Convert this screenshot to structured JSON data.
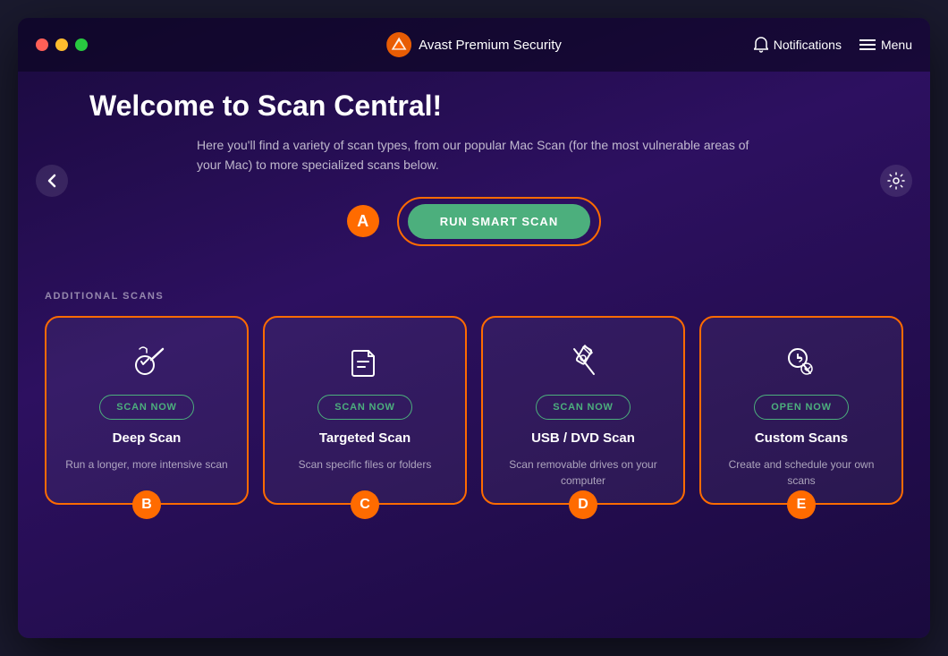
{
  "titlebar": {
    "app_name": "Avast Premium Security",
    "notifications_label": "Notifications",
    "menu_label": "Menu"
  },
  "header": {
    "back_label": "‹",
    "title": "Welcome to Scan Central!",
    "subtitle": "Here you'll find a variety of scan types, from our popular Mac Scan (for the most vulnerable areas of your Mac) to more specialized scans below.",
    "badge_a": "A"
  },
  "smart_scan": {
    "button_label": "RUN SMART SCAN"
  },
  "additional_scans": {
    "section_label": "ADDITIONAL SCANS",
    "cards": [
      {
        "id": "deep-scan",
        "action_label": "SCAN NOW",
        "title": "Deep Scan",
        "description": "Run a longer, more intensive scan",
        "badge": "B"
      },
      {
        "id": "targeted-scan",
        "action_label": "SCAN NOW",
        "title": "Targeted Scan",
        "description": "Scan specific files or folders",
        "badge": "C"
      },
      {
        "id": "usb-dvd-scan",
        "action_label": "SCAN NOW",
        "title": "USB / DVD Scan",
        "description": "Scan removable drives on your computer",
        "badge": "D"
      },
      {
        "id": "custom-scans",
        "action_label": "OPEN NOW",
        "title": "Custom Scans",
        "description": "Create and schedule your own scans",
        "badge": "E"
      }
    ]
  },
  "colors": {
    "orange": "#ff6b00",
    "green": "#4caf7d",
    "white": "#ffffff"
  }
}
